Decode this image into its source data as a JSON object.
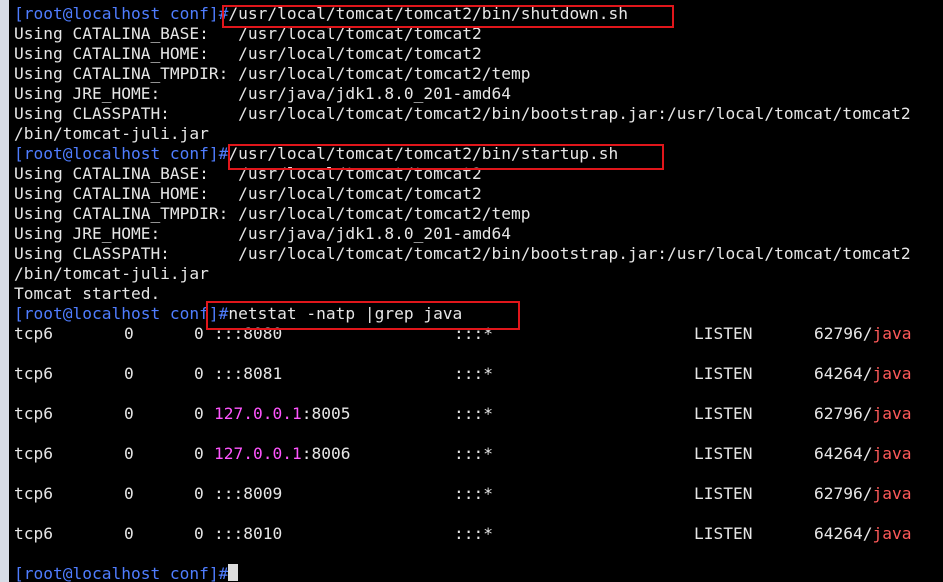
{
  "prompt": "[root@localhost conf]#",
  "blocks": [
    {
      "command": "/usr/local/tomcat/tomcat2/bin/shutdown.sh",
      "env": [
        [
          "Using CATALINA_BASE:   ",
          "/usr/local/tomcat/tomcat2"
        ],
        [
          "Using CATALINA_HOME:   ",
          "/usr/local/tomcat/tomcat2"
        ],
        [
          "Using CATALINA_TMPDIR: ",
          "/usr/local/tomcat/tomcat2/temp"
        ],
        [
          "Using JRE_HOME:        ",
          "/usr/java/jdk1.8.0_201-amd64"
        ],
        [
          "Using CLASSPATH:       ",
          "/usr/local/tomcat/tomcat2/bin/bootstrap.jar:/usr/local/tomcat/tomcat2"
        ]
      ],
      "wrap": "/bin/tomcat-juli.jar"
    },
    {
      "command": "/usr/local/tomcat/tomcat2/bin/startup.sh",
      "env": [
        [
          "Using CATALINA_BASE:   ",
          "/usr/local/tomcat/tomcat2"
        ],
        [
          "Using CATALINA_HOME:   ",
          "/usr/local/tomcat/tomcat2"
        ],
        [
          "Using CATALINA_TMPDIR: ",
          "/usr/local/tomcat/tomcat2/temp"
        ],
        [
          "Using JRE_HOME:        ",
          "/usr/java/jdk1.8.0_201-amd64"
        ],
        [
          "Using CLASSPATH:       ",
          "/usr/local/tomcat/tomcat2/bin/bootstrap.jar:/usr/local/tomcat/tomcat2"
        ]
      ],
      "wrap": "/bin/tomcat-juli.jar",
      "status": "Tomcat started."
    }
  ],
  "netstat": {
    "command": "netstat -natp |grep java",
    "rows": [
      {
        "proto": "tcp6",
        "recv": "0",
        "send": "0",
        "local_ip": "",
        "local_port": ":::8080",
        "foreign": ":::*",
        "state": "LISTEN",
        "pid": "62796/",
        "prog": "java"
      },
      {
        "proto": "tcp6",
        "recv": "0",
        "send": "0",
        "local_ip": "",
        "local_port": ":::8081",
        "foreign": ":::*",
        "state": "LISTEN",
        "pid": "64264/",
        "prog": "java"
      },
      {
        "proto": "tcp6",
        "recv": "0",
        "send": "0",
        "local_ip": "127.0.0.1",
        "local_port": ":8005",
        "foreign": ":::*",
        "state": "LISTEN",
        "pid": "62796/",
        "prog": "java"
      },
      {
        "proto": "tcp6",
        "recv": "0",
        "send": "0",
        "local_ip": "127.0.0.1",
        "local_port": ":8006",
        "foreign": ":::*",
        "state": "LISTEN",
        "pid": "64264/",
        "prog": "java"
      },
      {
        "proto": "tcp6",
        "recv": "0",
        "send": "0",
        "local_ip": "",
        "local_port": ":::8009",
        "foreign": ":::*",
        "state": "LISTEN",
        "pid": "62796/",
        "prog": "java"
      },
      {
        "proto": "tcp6",
        "recv": "0",
        "send": "0",
        "local_ip": "",
        "local_port": ":::8010",
        "foreign": ":::*",
        "state": "LISTEN",
        "pid": "64264/",
        "prog": "java"
      }
    ]
  },
  "colors": {
    "background": "#000000",
    "foreground": "#e6e6e6",
    "prompt": "#4f7dff",
    "loopback": "#ff55ff",
    "program": "#ff5a5a",
    "highlight_box": "#e0161b"
  }
}
